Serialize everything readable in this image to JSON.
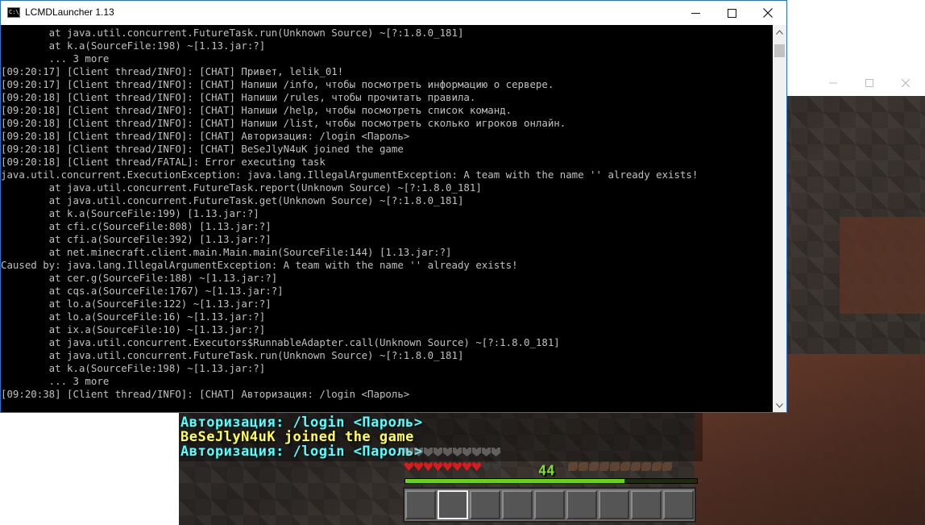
{
  "console": {
    "title": "LCMDLauncher 1.13",
    "icon_text": "C:\\_",
    "lines": [
      "        at java.util.concurrent.FutureTask.run(Unknown Source) ~[?:1.8.0_181]",
      "        at k.a(SourceFile:198) ~[1.13.jar:?]",
      "        ... 3 more",
      "[09:20:17] [Client thread/INFO]: [CHAT] Привет, lelik_01!",
      "[09:20:17] [Client thread/INFO]: [CHAT] Напиши /info, чтобы посмотреть информацию о сервере.",
      "[09:20:18] [Client thread/INFO]: [CHAT] Напиши /rules, чтобы прочитать правила.",
      "[09:20:18] [Client thread/INFO]: [CHAT] Напиши /help, чтобы посмотреть список команд.",
      "[09:20:18] [Client thread/INFO]: [CHAT] Напиши /list, чтобы посмотреть сколько игроков онлайн.",
      "[09:20:18] [Client thread/INFO]: [CHAT] Авторизация: /login <Пароль>",
      "[09:20:18] [Client thread/INFO]: [CHAT] BeSeJlyN4uK joined the game",
      "[09:20:18] [Client thread/FATAL]: Error executing task",
      "java.util.concurrent.ExecutionException: java.lang.IllegalArgumentException: A team with the name '' already exists!",
      "        at java.util.concurrent.FutureTask.report(Unknown Source) ~[?:1.8.0_181]",
      "        at java.util.concurrent.FutureTask.get(Unknown Source) ~[?:1.8.0_181]",
      "        at k.a(SourceFile:199) [1.13.jar:?]",
      "        at cfi.c(SourceFile:808) [1.13.jar:?]",
      "        at cfi.a(SourceFile:392) [1.13.jar:?]",
      "        at net.minecraft.client.main.Main.main(SourceFile:144) [1.13.jar:?]",
      "Caused by: java.lang.IllegalArgumentException: A team with the name '' already exists!",
      "        at cer.g(SourceFile:188) ~[1.13.jar:?]",
      "        at cqs.a(SourceFile:1767) ~[1.13.jar:?]",
      "        at lo.a(SourceFile:122) ~[1.13.jar:?]",
      "        at lo.a(SourceFile:16) ~[1.13.jar:?]",
      "        at ix.a(SourceFile:10) ~[1.13.jar:?]",
      "        at java.util.concurrent.Executors$RunnableAdapter.call(Unknown Source) ~[?:1.8.0_181]",
      "        at java.util.concurrent.FutureTask.run(Unknown Source) ~[?:1.8.0_181]",
      "        at k.a(SourceFile:198) ~[1.13.jar:?]",
      "        ... 3 more",
      "[09:20:38] [Client thread/INFO]: [CHAT] Авторизация: /login <Пароль>"
    ],
    "controls": {
      "minimize_icon": "minimize-icon",
      "maximize_icon": "maximize-icon",
      "close_icon": "close-icon"
    }
  },
  "game": {
    "chat_lines": [
      {
        "text": "Авторизация: /login <Пароль>",
        "color": "#55ffff"
      },
      {
        "text": "BeSeJlyN4uK joined the game",
        "color": "#ffff55"
      },
      {
        "text": "Авторизация: /login <Пароль>",
        "color": "#55ffff"
      }
    ],
    "xp_level": "44",
    "xp_progress": 0.75,
    "health_hearts_full": 8,
    "health_hearts_total": 10,
    "hotbar_slots": 9,
    "selected_slot": 1
  },
  "colors": {
    "console_bg": "#000000",
    "console_text": "#c0c0c0",
    "accent_border": "#2a6fc9"
  }
}
